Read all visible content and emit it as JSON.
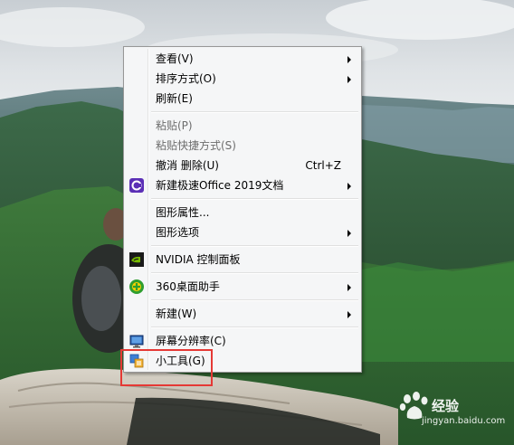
{
  "context_menu": {
    "items": [
      {
        "label": "查看(V)",
        "has_submenu": true
      },
      {
        "label": "排序方式(O)",
        "has_submenu": true
      },
      {
        "label": "刷新(E)"
      },
      {
        "label": "粘贴(P)",
        "disabled": true
      },
      {
        "label": "粘贴快捷方式(S)",
        "disabled": true
      },
      {
        "label": "撤消 删除(U)",
        "shortcut": "Ctrl+Z"
      },
      {
        "label": "新建极速Office 2019文档",
        "icon": "office-icon",
        "has_submenu": true
      },
      {
        "label": "图形属性..."
      },
      {
        "label": "图形选项",
        "has_submenu": true
      },
      {
        "label": "NVIDIA 控制面板",
        "icon": "nvidia-icon"
      },
      {
        "label": "360桌面助手",
        "icon": "360-icon",
        "has_submenu": true
      },
      {
        "label": "新建(W)",
        "has_submenu": true
      },
      {
        "label": "屏幕分辨率(C)",
        "icon": "screen-resolution-icon"
      },
      {
        "label": "小工具(G)",
        "icon": "gadgets-icon"
      }
    ]
  },
  "watermark": {
    "text": "经验",
    "url": "jingyan.baidu.com"
  },
  "colors": {
    "highlight_box": "#e53935",
    "menu_bg": "#f5f6f7"
  }
}
